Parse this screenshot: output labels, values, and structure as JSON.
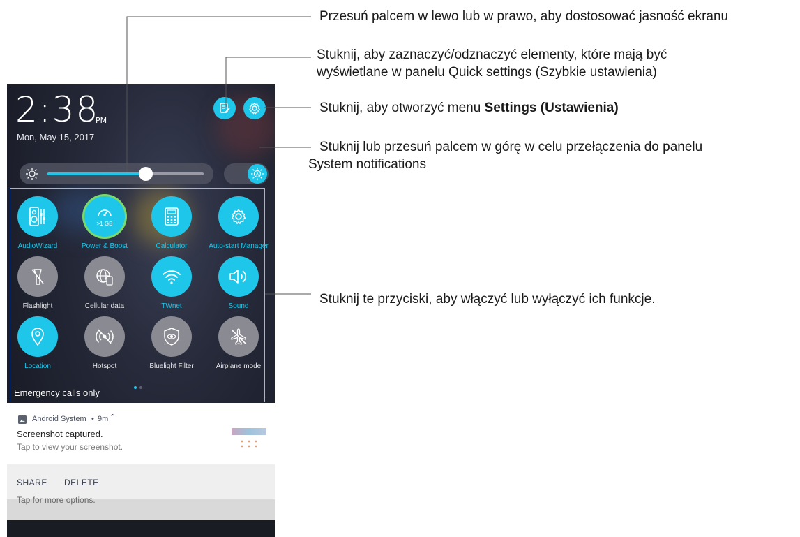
{
  "status": {
    "time": "2:38",
    "ampm": "PM",
    "date": "Mon, May 15, 2017"
  },
  "brightness": {
    "level": 0.63,
    "icon": "sun-icon",
    "auto_icon": "auto-brightness-icon"
  },
  "top_buttons": {
    "edit_icon": "edit-icon",
    "settings_icon": "gear-icon"
  },
  "tiles": [
    {
      "label": "AudioWizard",
      "icon": "audio-wizard-icon",
      "active": true
    },
    {
      "label": "Power & Boost",
      "icon": "speedometer-icon",
      "active": true,
      "sub": ">1 GB"
    },
    {
      "label": "Calculator",
      "icon": "calculator-icon",
      "active": true
    },
    {
      "label": "Auto-start Manager",
      "icon": "gear-icon",
      "active": true
    },
    {
      "label": "Flashlight",
      "icon": "flashlight-off-icon",
      "active": false
    },
    {
      "label": "Cellular data",
      "icon": "globe-icon",
      "active": false
    },
    {
      "label": "TWnet",
      "icon": "wifi-icon",
      "active": true
    },
    {
      "label": "Sound",
      "icon": "speaker-icon",
      "active": true
    },
    {
      "label": "Location",
      "icon": "location-pin-icon",
      "active": true
    },
    {
      "label": "Hotspot",
      "icon": "hotspot-off-icon",
      "active": false
    },
    {
      "label": "Bluelight Filter",
      "icon": "eye-shield-icon",
      "active": false
    },
    {
      "label": "Airplane mode",
      "icon": "airplane-off-icon",
      "active": false
    }
  ],
  "emergency": "Emergency calls only",
  "notification": {
    "app": "Android System",
    "time": "9m",
    "title": "Screenshot captured.",
    "body": "Tap to view your screenshot.",
    "actions": [
      "SHARE",
      "DELETE"
    ],
    "below_text": "Tap for more options."
  },
  "annotations": {
    "brightness": "Przesuń palcem w lewo lub w prawo, aby dostosować jasność ekranu",
    "quick_settings_1": "Stuknij, aby zaznaczyć/odznaczyć elementy, które mają być",
    "quick_settings_2": "wyświetlane w panelu Quick settings (Szybkie ustawienia)",
    "settings_prefix": "Stuknij, aby otworzyć menu ",
    "settings_bold": "Settings (Ustawienia)",
    "notifications_1": "Stuknij lub przesuń palcem w górę w celu przełączenia do panelu",
    "notifications_2": "System notifications",
    "tiles": "Stuknij te przyciski, aby włączyć lub wyłączyć ich funkcje."
  },
  "colors": {
    "accent": "#1ec7ea",
    "inactive": "#8a8a92",
    "panel": "#1c1f2b"
  }
}
